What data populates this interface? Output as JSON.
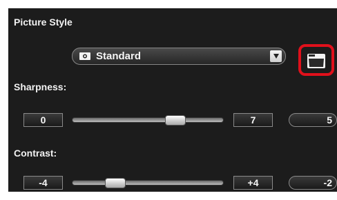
{
  "section_title": "Picture Style",
  "style_dropdown": {
    "value": "Standard",
    "icon": "camera-icon"
  },
  "folder_button": {
    "icon": "folder-icon"
  },
  "sharpness": {
    "label": "Sharpness:",
    "min": "0",
    "max": "7",
    "value": "5",
    "slider_fraction": 0.71
  },
  "contrast": {
    "label": "Contrast:",
    "min": "-4",
    "max": "+4",
    "value": "-2",
    "slider_fraction": 0.25
  },
  "colors": {
    "panel": "#1c1c1c",
    "highlight": "#e0101b"
  }
}
